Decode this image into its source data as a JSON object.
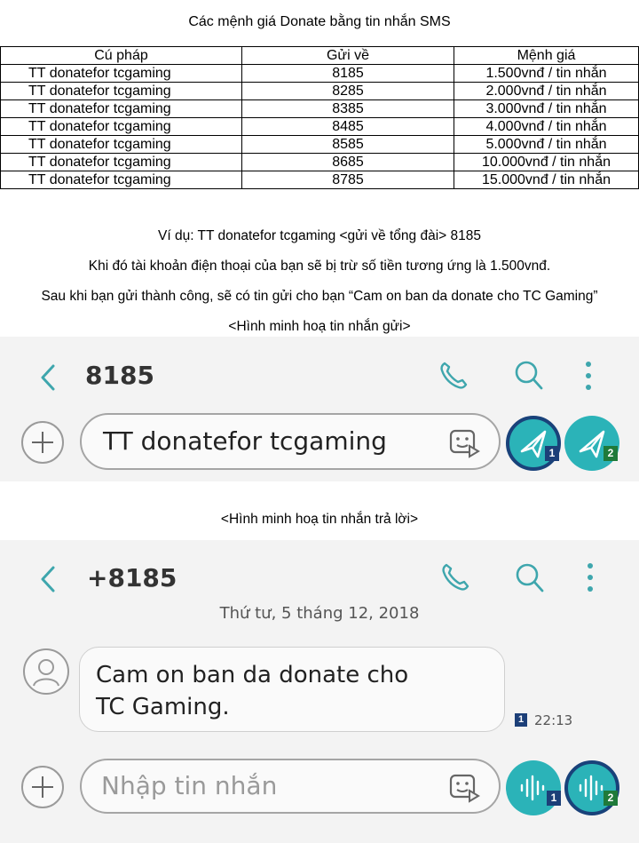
{
  "title": "Các mệnh giá Donate bằng tin nhắn SMS",
  "table": {
    "headers": [
      "Cú pháp",
      "Gửi về",
      "Mệnh giá"
    ],
    "rows": [
      [
        "TT donatefor tcgaming",
        "8185",
        "1.500vnđ / tin nhắn"
      ],
      [
        "TT donatefor tcgaming",
        "8285",
        "2.000vnđ / tin nhắn"
      ],
      [
        "TT donatefor tcgaming",
        "8385",
        "3.000vnđ / tin nhắn"
      ],
      [
        "TT donatefor tcgaming",
        "8485",
        "4.000vnđ / tin nhắn"
      ],
      [
        "TT donatefor tcgaming",
        "8585",
        "5.000vnđ / tin nhắn"
      ],
      [
        "TT donatefor tcgaming",
        "8685",
        "10.000vnđ / tin nhắn"
      ],
      [
        "TT donatefor tcgaming",
        "8785",
        "15.000vnđ / tin nhắn"
      ]
    ]
  },
  "notes": {
    "example": "Ví dụ: TT donatefor tcgaming <gửi về tổng đài> 8185",
    "deduct": "Khi đó tài khoản điện thoại của bạn sẽ bị trừ số tiền tương ứng là 1.500vnđ.",
    "reply": "Sau khi bạn gửi thành công, sẽ có tin gửi cho bạn “Cam on ban da donate cho TC Gaming”",
    "caption_send": "<Hình minh hoạ tin nhắn gửi>",
    "caption_reply": "<Hình minh hoạ tin nhắn trả lời>"
  },
  "send_screen": {
    "contact": "8185",
    "input_text": "TT donatefor tcgaming",
    "sim1": "1",
    "sim2": "2",
    "icons": [
      "back-arrow-icon",
      "phone-icon",
      "search-icon",
      "more-vertical-icon",
      "plus-icon",
      "sticker-icon",
      "send-icon"
    ]
  },
  "reply_screen": {
    "contact": "+8185",
    "date": "Thứ tư, 5 tháng 12, 2018",
    "message_line1": "Cam on ban da donate cho",
    "message_line2": "TC Gaming.",
    "sim": "1",
    "time": "22:13",
    "input_placeholder": "Nhập tin nhắn",
    "sim1": "1",
    "sim2": "2",
    "icons": [
      "back-arrow-icon",
      "phone-icon",
      "search-icon",
      "more-vertical-icon",
      "avatar-icon",
      "plus-icon",
      "sticker-icon",
      "voice-icon"
    ]
  },
  "colors": {
    "accent_teal": "#2bb3b8",
    "icon_teal": "#3ea6ad",
    "sim1_blue": "#1c3f78",
    "sim2_green": "#1f7a3a",
    "panel_bg": "#f3f3f3"
  }
}
